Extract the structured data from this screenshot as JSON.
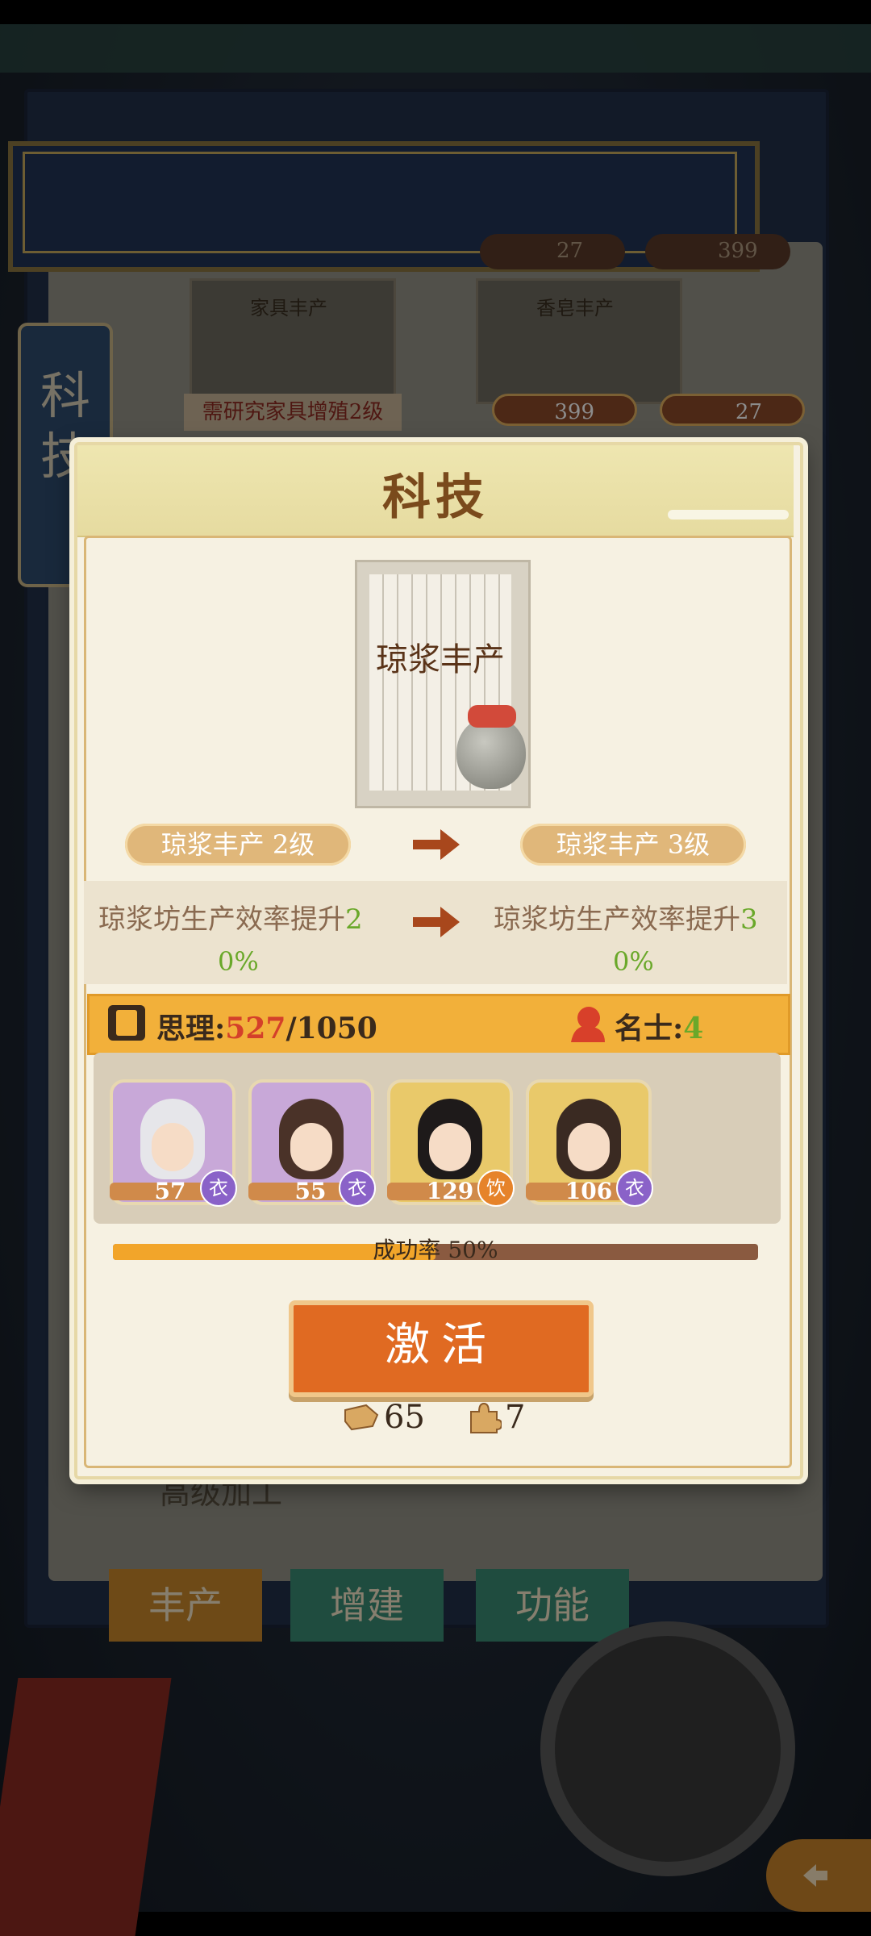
{
  "background": {
    "side_tab_chars": [
      "科",
      "技"
    ],
    "resources": [
      "27",
      "399"
    ],
    "cards": [
      {
        "title": "家具丰产"
      },
      {
        "title": "香皂丰产"
      }
    ],
    "requirement": "需研究家具增殖2级",
    "card_costs": [
      "399",
      "27"
    ],
    "bottom_tabs": [
      "丰产",
      "增建",
      "功能"
    ],
    "list_item": "高级加工"
  },
  "dialog": {
    "title": "科技",
    "tech_card_name": "琼浆丰产",
    "level_from": "琼浆丰产 2级",
    "level_to": "琼浆丰产 3级",
    "effect_from": {
      "text": "琼浆坊生产效率提升",
      "num": "2",
      "line2": "0%"
    },
    "effect_to": {
      "text": "琼浆坊生产效率提升",
      "num": "3",
      "line2": "0%"
    },
    "resources": {
      "thinking_label": "思理:",
      "thinking_current": "527",
      "thinking_total": "/1050",
      "scholar_label": "名士:",
      "scholar_count": "4"
    },
    "advisors": [
      {
        "level": "57",
        "badge": "衣"
      },
      {
        "level": "55",
        "badge": "衣"
      },
      {
        "level": "129",
        "badge": "饮"
      },
      {
        "level": "106",
        "badge": "衣"
      }
    ],
    "success": {
      "label": "成功率 50%",
      "rate": 0.5
    },
    "activate_label": "激活",
    "costs": [
      "65",
      "7"
    ]
  }
}
